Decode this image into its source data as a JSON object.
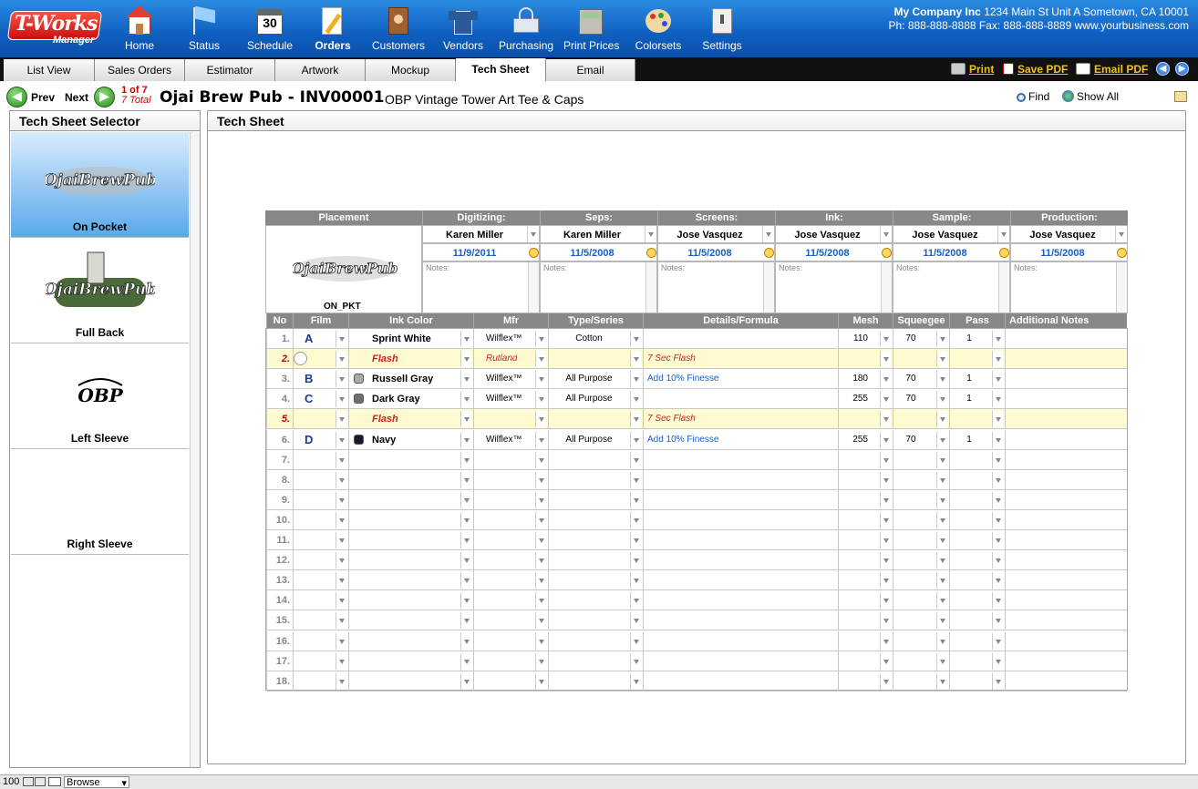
{
  "app": {
    "logo_main": "T-Works",
    "logo_sub": "Manager"
  },
  "nav": [
    {
      "id": "home",
      "label": "Home",
      "icon": "home-icon"
    },
    {
      "id": "status",
      "label": "Status",
      "icon": "flag-icon"
    },
    {
      "id": "schedule",
      "label": "Schedule",
      "icon": "calendar-icon",
      "badge": "30"
    },
    {
      "id": "orders",
      "label": "Orders",
      "icon": "notepad-pencil-icon",
      "active": true
    },
    {
      "id": "customers",
      "label": "Customers",
      "icon": "address-book-icon"
    },
    {
      "id": "vendors",
      "label": "Vendors",
      "icon": "shirt-icon"
    },
    {
      "id": "purchasing",
      "label": "Purchasing",
      "icon": "basket-icon"
    },
    {
      "id": "print_prices",
      "label": "Print Prices",
      "icon": "calculator-icon"
    },
    {
      "id": "colorsets",
      "label": "Colorsets",
      "icon": "palette-icon"
    },
    {
      "id": "settings",
      "label": "Settings",
      "icon": "switch-icon"
    }
  ],
  "company": {
    "name": "My Company Inc",
    "address": "1234 Main St Unit A Sometown, CA 10001",
    "contact": "Ph: 888-888-8888 Fax: 888-888-8889 www.yourbusiness.com"
  },
  "tabs": [
    {
      "label": "List View"
    },
    {
      "label": "Sales Orders"
    },
    {
      "label": "Estimator"
    },
    {
      "label": "Artwork"
    },
    {
      "label": "Mockup"
    },
    {
      "label": "Tech Sheet",
      "active": true
    },
    {
      "label": "Email"
    }
  ],
  "actions": {
    "print": "Print",
    "save_pdf": "Save PDF",
    "email_pdf": "Email PDF"
  },
  "record": {
    "prev": "Prev",
    "next": "Next",
    "position": "1 of 7",
    "total": "7 Total",
    "title": "Ojai Brew Pub - INV00001",
    "subtitle": "OBP Vintage Tower Art Tee & Caps"
  },
  "toolbar": {
    "find": "Find",
    "show_all": "Show All"
  },
  "selector": {
    "title": "Tech Sheet Selector",
    "items": [
      {
        "label": "On Pocket",
        "art": "ojai-brew-pub-logo",
        "active": true
      },
      {
        "label": "Full Back",
        "art": "ojai-brew-pub-tower-art"
      },
      {
        "label": "Left Sleeve",
        "art": "obp-logo"
      },
      {
        "label": "Right Sleeve",
        "art": ""
      }
    ]
  },
  "techsheet": {
    "title": "Tech Sheet",
    "placement_header": "Placement",
    "placement_code": "ON_PKT",
    "stages": [
      {
        "header": "Digitizing:",
        "person": "Karen Miller",
        "date": "11/9/2011",
        "notes": "Notes:"
      },
      {
        "header": "Seps:",
        "person": "Karen Miller",
        "date": "11/5/2008",
        "notes": "Notes:"
      },
      {
        "header": "Screens:",
        "person": "Jose Vasquez",
        "date": "11/5/2008",
        "notes": "Notes:"
      },
      {
        "header": "Ink:",
        "person": "Jose Vasquez",
        "date": "11/5/2008",
        "notes": "Notes:"
      },
      {
        "header": "Sample:",
        "person": "Jose Vasquez",
        "date": "11/5/2008",
        "notes": "Notes:"
      },
      {
        "header": "Production:",
        "person": "Jose Vasquez",
        "date": "11/5/2008",
        "notes": "Notes:"
      }
    ],
    "columns": {
      "no": "No",
      "film": "Film",
      "ink": "Ink Color",
      "mfr": "Mfr",
      "type": "Type/Series",
      "details": "Details/Formula",
      "mesh": "Mesh",
      "squeegee": "Squeegee",
      "pass": "Pass",
      "notes": "Additional Notes"
    },
    "rows": [
      {
        "no": "1.",
        "film": "A",
        "ink": "Sprint White",
        "swatch": "",
        "mfr": "Wilflex™",
        "type": "Cotton",
        "details": "",
        "mesh": "110",
        "squeegee": "70",
        "pass": "1",
        "flash": false
      },
      {
        "no": "2.",
        "film": "",
        "ink": "Flash",
        "swatch": "",
        "mfr": "Rutland",
        "type": "",
        "details": "7 Sec Flash",
        "mesh": "",
        "squeegee": "",
        "pass": "",
        "flash": true
      },
      {
        "no": "3.",
        "film": "B",
        "ink": "Russell Gray",
        "swatch": "#a8aab0",
        "mfr": "Wilflex™",
        "type": "All Purpose",
        "details": "Add 10% Finesse",
        "mesh": "180",
        "squeegee": "70",
        "pass": "1",
        "flash": false
      },
      {
        "no": "4.",
        "film": "C",
        "ink": "Dark Gray",
        "swatch": "#6e7078",
        "mfr": "Wilflex™",
        "type": "All Purpose",
        "details": "",
        "mesh": "255",
        "squeegee": "70",
        "pass": "1",
        "flash": false
      },
      {
        "no": "5.",
        "film": "",
        "ink": "Flash",
        "swatch": "",
        "mfr": "",
        "type": "",
        "details": "7 Sec Flash",
        "mesh": "",
        "squeegee": "",
        "pass": "",
        "flash": true
      },
      {
        "no": "6.",
        "film": "D",
        "ink": "Navy",
        "swatch": "#141830",
        "mfr": "Wilflex™",
        "type": "All Purpose",
        "details": "Add 10% Finesse",
        "mesh": "255",
        "squeegee": "70",
        "pass": "1",
        "flash": false
      },
      {
        "no": "7.",
        "film": "",
        "ink": "",
        "swatch": "",
        "mfr": "",
        "type": "",
        "details": "",
        "mesh": "",
        "squeegee": "",
        "pass": "",
        "flash": false
      },
      {
        "no": "8.",
        "film": "",
        "ink": "",
        "swatch": "",
        "mfr": "",
        "type": "",
        "details": "",
        "mesh": "",
        "squeegee": "",
        "pass": "",
        "flash": false
      },
      {
        "no": "9.",
        "film": "",
        "ink": "",
        "swatch": "",
        "mfr": "",
        "type": "",
        "details": "",
        "mesh": "",
        "squeegee": "",
        "pass": "",
        "flash": false
      },
      {
        "no": "10.",
        "film": "",
        "ink": "",
        "swatch": "",
        "mfr": "",
        "type": "",
        "details": "",
        "mesh": "",
        "squeegee": "",
        "pass": "",
        "flash": false
      },
      {
        "no": "11.",
        "film": "",
        "ink": "",
        "swatch": "",
        "mfr": "",
        "type": "",
        "details": "",
        "mesh": "",
        "squeegee": "",
        "pass": "",
        "flash": false
      },
      {
        "no": "12.",
        "film": "",
        "ink": "",
        "swatch": "",
        "mfr": "",
        "type": "",
        "details": "",
        "mesh": "",
        "squeegee": "",
        "pass": "",
        "flash": false
      },
      {
        "no": "13.",
        "film": "",
        "ink": "",
        "swatch": "",
        "mfr": "",
        "type": "",
        "details": "",
        "mesh": "",
        "squeegee": "",
        "pass": "",
        "flash": false
      },
      {
        "no": "14.",
        "film": "",
        "ink": "",
        "swatch": "",
        "mfr": "",
        "type": "",
        "details": "",
        "mesh": "",
        "squeegee": "",
        "pass": "",
        "flash": false
      },
      {
        "no": "15.",
        "film": "",
        "ink": "",
        "swatch": "",
        "mfr": "",
        "type": "",
        "details": "",
        "mesh": "",
        "squeegee": "",
        "pass": "",
        "flash": false
      },
      {
        "no": "16.",
        "film": "",
        "ink": "",
        "swatch": "",
        "mfr": "",
        "type": "",
        "details": "",
        "mesh": "",
        "squeegee": "",
        "pass": "",
        "flash": false
      },
      {
        "no": "17.",
        "film": "",
        "ink": "",
        "swatch": "",
        "mfr": "",
        "type": "",
        "details": "",
        "mesh": "",
        "squeegee": "",
        "pass": "",
        "flash": false
      },
      {
        "no": "18.",
        "film": "",
        "ink": "",
        "swatch": "",
        "mfr": "",
        "type": "",
        "details": "",
        "mesh": "",
        "squeegee": "",
        "pass": "",
        "flash": false
      }
    ]
  },
  "colors": {
    "flash_row": "#fffbd0",
    "flash_text": "#cc2222",
    "link": "#1560c8",
    "header_gray": "#888888",
    "film_letter": "#1a3a9a"
  },
  "statusbar": {
    "zoom": "100",
    "mode": "Browse"
  }
}
